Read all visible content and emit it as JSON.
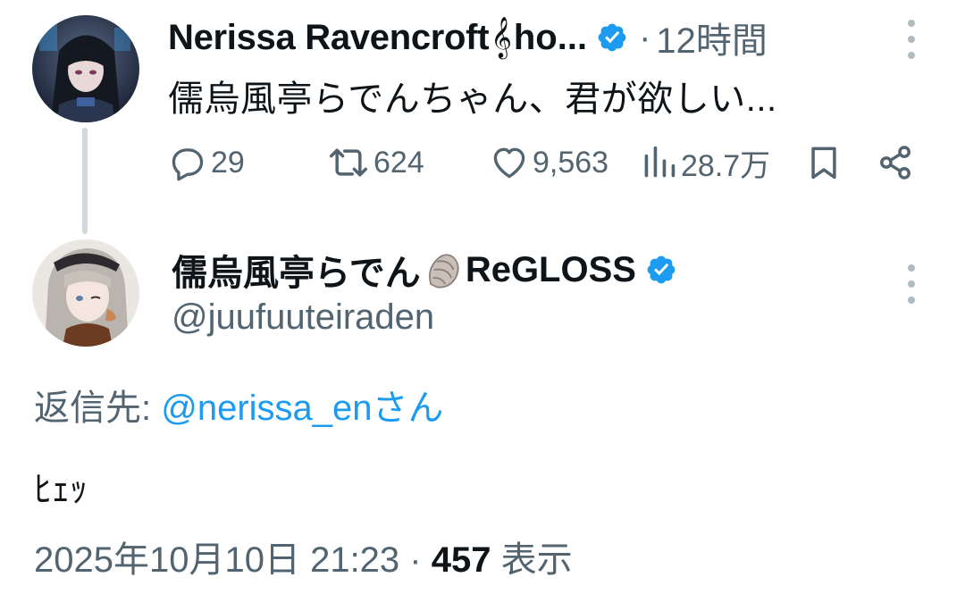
{
  "parent_tweet": {
    "name": "Nerissa Ravencroft",
    "name_emoji": "𝄞",
    "name_suffix": "ho...",
    "verified": true,
    "dot": "·",
    "time": "12時間",
    "text": "儒烏風亭らでんちゃん、君が欲しい...",
    "actions": {
      "replies": "29",
      "retweets": "624",
      "likes": "9,563",
      "views": "28.7万"
    },
    "icons": [
      "reply-icon",
      "retweet-icon",
      "like-icon",
      "views-icon",
      "bookmark-icon",
      "share-icon",
      "more-icon"
    ]
  },
  "reply_tweet": {
    "name": "儒烏風亭らでん",
    "name_emoji": "shell",
    "name_suffix": "ReGLOSS",
    "verified": true,
    "handle": "@juufuuteiraden",
    "reply_to_label": "返信先: ",
    "reply_to_mention": "@nerissa_enさん",
    "text": "ﾋｪｯ",
    "timestamp": "2025年10月10日 21:23",
    "meta_dot": " · ",
    "views_count": "457",
    "views_label": " 表示"
  },
  "colors": {
    "text": "#0f1419",
    "secondary": "#536471",
    "link": "#1d9bf0",
    "verified": "#1d9bf0",
    "thread_line": "#cfd9de"
  }
}
